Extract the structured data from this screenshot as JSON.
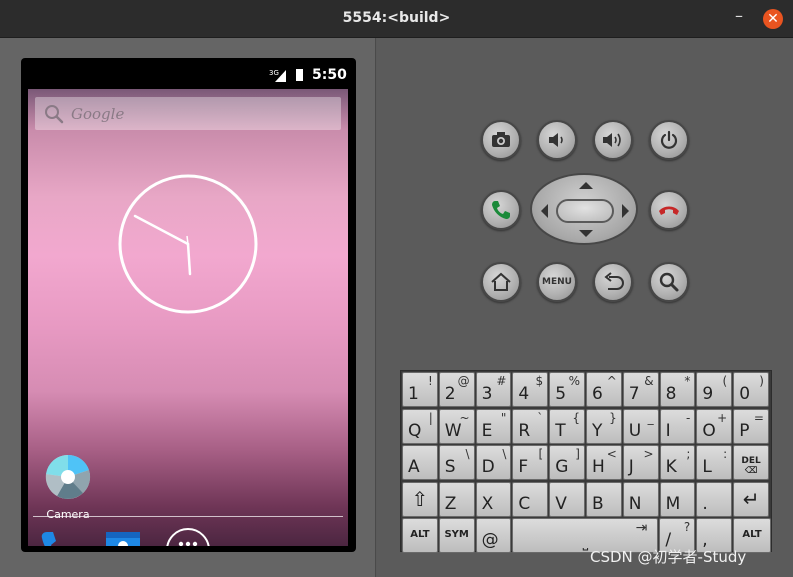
{
  "window": {
    "title": "5554:<build>",
    "minimize_glyph": "–",
    "close_glyph": "✕",
    "accent": "#e95420"
  },
  "device": {
    "statusbar": {
      "network": "3G",
      "time": "5:50"
    },
    "search": {
      "placeholder": "Google",
      "icon": "search-icon"
    },
    "clock": {
      "icon": "analog-clock-widget"
    },
    "apps": [
      {
        "label": "Camera",
        "icon": "camera-shutter-icon"
      }
    ],
    "dock": [
      {
        "icon": "phone-icon"
      },
      {
        "icon": "contacts-icon"
      },
      {
        "icon": "app-drawer-icon"
      }
    ]
  },
  "controls": {
    "row1": [
      "camera-icon",
      "volume-down-icon",
      "volume-up-icon",
      "power-icon"
    ],
    "row2": [
      "call-icon",
      "dpad",
      "end-call-icon"
    ],
    "row3": [
      "home-icon",
      "menu",
      "back-icon",
      "search-icon"
    ],
    "menu_label": "MENU"
  },
  "keyboard": {
    "rows": [
      [
        {
          "m": "1",
          "s": "!"
        },
        {
          "m": "2",
          "s": "@"
        },
        {
          "m": "3",
          "s": "#"
        },
        {
          "m": "4",
          "s": "$"
        },
        {
          "m": "5",
          "s": "%"
        },
        {
          "m": "6",
          "s": "^"
        },
        {
          "m": "7",
          "s": "&"
        },
        {
          "m": "8",
          "s": "*"
        },
        {
          "m": "9",
          "s": "("
        },
        {
          "m": "0",
          "s": ")"
        }
      ],
      [
        {
          "m": "Q",
          "s": "|"
        },
        {
          "m": "W",
          "s": "~"
        },
        {
          "m": "E",
          "s": "\""
        },
        {
          "m": "R",
          "s": "`"
        },
        {
          "m": "T",
          "s": "{"
        },
        {
          "m": "Y",
          "s": "}"
        },
        {
          "m": "U",
          "s": "_"
        },
        {
          "m": "I",
          "s": "-"
        },
        {
          "m": "O",
          "s": "+"
        },
        {
          "m": "P",
          "s": "="
        }
      ],
      [
        {
          "m": "A",
          "s": ""
        },
        {
          "m": "S",
          "s": "\\"
        },
        {
          "m": "D",
          "s": "\\"
        },
        {
          "m": "F",
          "s": "["
        },
        {
          "m": "G",
          "s": "]"
        },
        {
          "m": "H",
          "s": "<"
        },
        {
          "m": "J",
          "s": ">"
        },
        {
          "m": "K",
          "s": ";"
        },
        {
          "m": "L",
          "s": ":"
        },
        {
          "m": "DEL ⌫",
          "s": ""
        }
      ],
      [
        {
          "m": "⇧",
          "s": ""
        },
        {
          "m": "Z",
          "s": ""
        },
        {
          "m": "X",
          "s": ""
        },
        {
          "m": "C",
          "s": ""
        },
        {
          "m": "V",
          "s": ""
        },
        {
          "m": "B",
          "s": ""
        },
        {
          "m": "N",
          "s": ""
        },
        {
          "m": "M",
          "s": ""
        },
        {
          "m": ".",
          "s": ""
        },
        {
          "m": "↵",
          "s": ""
        }
      ]
    ],
    "bottom": {
      "alt": "ALT",
      "sym": "SYM",
      "at": "@",
      "space_glyph": "⎵",
      "tab_glyph": "⇥",
      "slash": "/",
      "question": "?",
      "comma": ",",
      "alt_right": "ALT"
    }
  },
  "watermark": "CSDN @初学者-Study"
}
